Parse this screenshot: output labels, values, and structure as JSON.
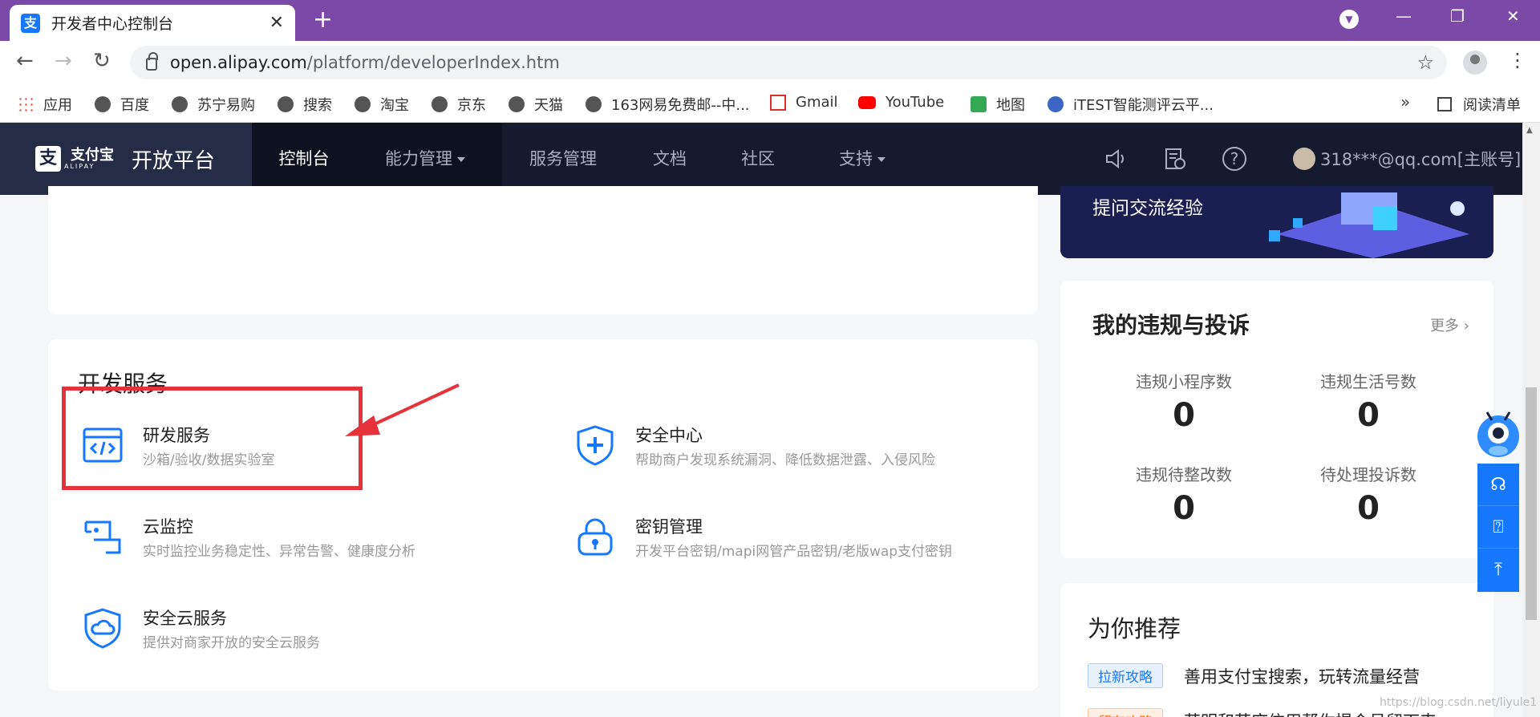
{
  "browser": {
    "tab_title": "开发者中心控制台",
    "favicon_glyph": "支",
    "url_host": "open.alipay.com",
    "url_path": "/platform/developerIndex.htm",
    "bookmarks": [
      {
        "label": "应用",
        "icon": "apps-icon"
      },
      {
        "label": "百度",
        "icon": "globe-icon"
      },
      {
        "label": "苏宁易购",
        "icon": "globe-icon"
      },
      {
        "label": "搜索",
        "icon": "globe-icon"
      },
      {
        "label": "淘宝",
        "icon": "globe-icon"
      },
      {
        "label": "京东",
        "icon": "globe-icon"
      },
      {
        "label": "天猫",
        "icon": "globe-icon"
      },
      {
        "label": "163网易免费邮--中...",
        "icon": "globe-icon"
      },
      {
        "label": "Gmail",
        "icon": "gmail-icon"
      },
      {
        "label": "YouTube",
        "icon": "youtube-icon"
      },
      {
        "label": "地图",
        "icon": "maps-icon"
      },
      {
        "label": "iTEST智能测评云平...",
        "icon": "itest-icon"
      }
    ],
    "bookmarks_more": "»",
    "reading_list": "阅读清单"
  },
  "appnav": {
    "brand_cn": "支付宝",
    "brand_en": "ALIPAY",
    "brand_glyph": "支",
    "title": "开放平台",
    "items": [
      {
        "label": "控制台",
        "active": true
      },
      {
        "label": "能力管理",
        "dropdown": true
      },
      {
        "label": "服务管理"
      },
      {
        "label": "文档"
      },
      {
        "label": "社区"
      },
      {
        "label": "支持",
        "dropdown": true
      }
    ],
    "user": "318***@qq.com[主账号]"
  },
  "banner": {
    "text": "提问交流经验"
  },
  "dev_services": {
    "title": "开发服务",
    "items": [
      {
        "name": "研发服务",
        "desc": "沙箱/验收/数据实验室",
        "icon": "code-window-icon"
      },
      {
        "name": "安全中心",
        "desc": "帮助商户发现系统漏洞、降低数据泄露、入侵风险",
        "icon": "shield-plus-icon"
      },
      {
        "name": "云监控",
        "desc": "实时监控业务稳定性、异常告警、健康度分析",
        "icon": "monitor-icon"
      },
      {
        "name": "密钥管理",
        "desc": "开发平台密钥/mapi网管产品密钥/老版wap支付密钥",
        "icon": "lock-icon"
      },
      {
        "name": "安全云服务",
        "desc": "提供对商家开放的安全云服务",
        "icon": "shield-cloud-icon"
      }
    ]
  },
  "violations": {
    "title": "我的违规与投诉",
    "more": "更多",
    "stats": [
      {
        "label": "违规小程序数",
        "value": "0"
      },
      {
        "label": "违规生活号数",
        "value": "0"
      },
      {
        "label": "违规待整改数",
        "value": "0"
      },
      {
        "label": "待处理投诉数",
        "value": "0"
      }
    ]
  },
  "recommend": {
    "title": "为你推荐",
    "items": [
      {
        "tag": "拉新攻略",
        "text": "善用支付宝搜索，玩转流量经营"
      },
      {
        "tag": "留存攻略",
        "text": "芝明和芝麻信用帮你提会员留下来"
      }
    ]
  },
  "watermark": "https://blog.csdn.net/liyule1",
  "colors": {
    "accent": "#1677ff",
    "highlight": "#e6323a",
    "nav_bg": "#151a2e",
    "tab_bar": "#7b4aa8"
  }
}
